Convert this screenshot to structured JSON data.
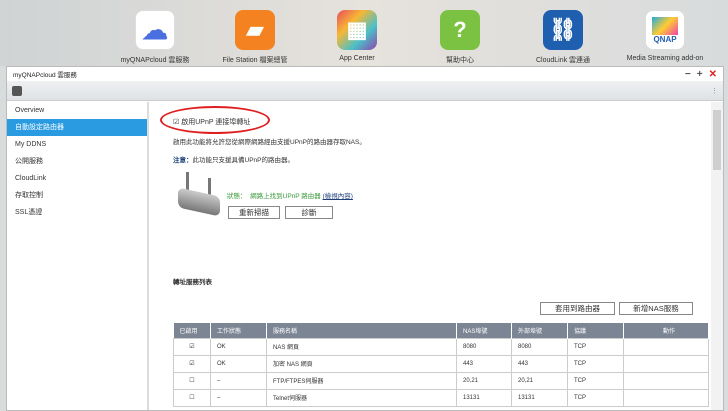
{
  "desktop": {
    "apps": [
      {
        "label": "myQNAPcloud 雲服務",
        "icon": "cloud-icon",
        "color": "#ffffff"
      },
      {
        "label": "File Station 檔案總管",
        "icon": "folder-icon",
        "color": "#f58220"
      },
      {
        "label": "App Center",
        "icon": "grid-icon",
        "color": "#e04a7a"
      },
      {
        "label": "幫助中心",
        "icon": "help-icon",
        "color": "#7cc242"
      },
      {
        "label": "CloudLink 雲連通",
        "icon": "link-icon",
        "color": "#1f5fb0"
      },
      {
        "label": "Media Streaming add-on",
        "icon": "media-icon",
        "color": "#ffffff"
      }
    ]
  },
  "window": {
    "title": "myQNAPcloud 雲服務"
  },
  "sidebar": {
    "items": [
      "Overview",
      "自動設定路由器",
      "My DDNS",
      "公開服務",
      "CloudLink",
      "存取控制",
      "SSL憑證"
    ]
  },
  "main": {
    "upnp_label": "啟用UPnP 連接埠轉址",
    "description": "啟用此功能將允許您從網際網路經由支援UPnP的路由器存取NAS。",
    "note_label": "注意：",
    "note_text": "此功能只支援具備UPnP的路由器。",
    "status_label": "狀態：",
    "status_text": "網路上找到UPnP 路由器",
    "details_link": "(檢視內容)",
    "rescan": "重新掃描",
    "diagnose": "診斷",
    "list_title": "轉址服務列表",
    "apply": "套用到路由器",
    "add": "新增NAS服務"
  },
  "table": {
    "headers": [
      "已啟用",
      "工作狀態",
      "服務名稱",
      "NAS埠號",
      "外部埠號",
      "協議",
      "動作"
    ],
    "rows": [
      {
        "enabled": true,
        "status": "OK",
        "name": "NAS 網頁",
        "nas": "8080",
        "ext": "8080",
        "proto": "TCP"
      },
      {
        "enabled": true,
        "status": "OK",
        "name": "加密 NAS 網頁",
        "nas": "443",
        "ext": "443",
        "proto": "TCP"
      },
      {
        "enabled": false,
        "status": "–",
        "name": "FTP/FTPES伺服器",
        "nas": "20,21",
        "ext": "20,21",
        "proto": "TCP"
      },
      {
        "enabled": false,
        "status": "–",
        "name": "Telnet伺服器",
        "nas": "13131",
        "ext": "13131",
        "proto": "TCP"
      }
    ]
  }
}
